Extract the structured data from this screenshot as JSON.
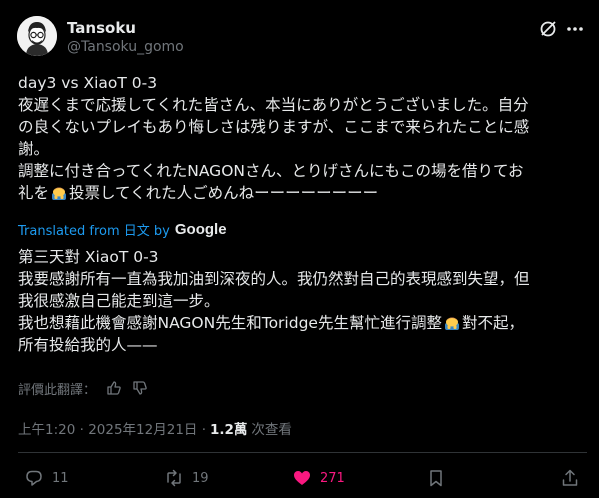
{
  "author": {
    "display_name": "Tansoku",
    "handle": "@Tansoku_gomo"
  },
  "original_text": {
    "line1": "day3 vs XiaoT 0-3",
    "line2": "夜遅くまで応援してくれた皆さん、本当にありがとうございました。自分",
    "line3": "の良くないプレイもあり悔しさは残りますが、ここまで来られたことに感",
    "line4": "謝。",
    "line5": "調整に付き合ってくれたNAGONさん、とりげさんにもこの場を借りてお",
    "line6_before": "礼を",
    "line6_after": "投票してくれた人ごめんねーーーーーーーー"
  },
  "translation": {
    "label": "Translated from 日文 by",
    "provider": "Google",
    "line1": "第三天對 XiaoT 0-3",
    "line2": "我要感謝所有一直為我加油到深夜的人。我仍然對自己的表現感到失望，但",
    "line3": "我很感激自己能走到這一步。",
    "line4_before": "我也想藉此機會感謝NAGON先生和Toridge先生幫忙進行調整",
    "line4_after": "對不起，",
    "line5": "所有投給我的人——"
  },
  "rate": {
    "label": "評價此翻譯："
  },
  "meta": {
    "timestamp": "上午1:20 · 2025年12月21日 ·",
    "views": "1.2萬",
    "views_label": "次查看"
  },
  "actions": {
    "replies": "11",
    "reposts": "19",
    "likes": "271"
  },
  "colors": {
    "background": "#000000",
    "text": "#e7e9ea",
    "secondary": "#71767b",
    "link": "#1d9bf0",
    "like": "#f91880"
  },
  "icons": [
    "avatar",
    "grok-icon",
    "more-icon",
    "emoji-man-bowing",
    "thumbs-up-icon",
    "thumbs-down-icon",
    "reply-icon",
    "repost-icon",
    "heart-icon",
    "bookmark-icon",
    "share-icon"
  ]
}
